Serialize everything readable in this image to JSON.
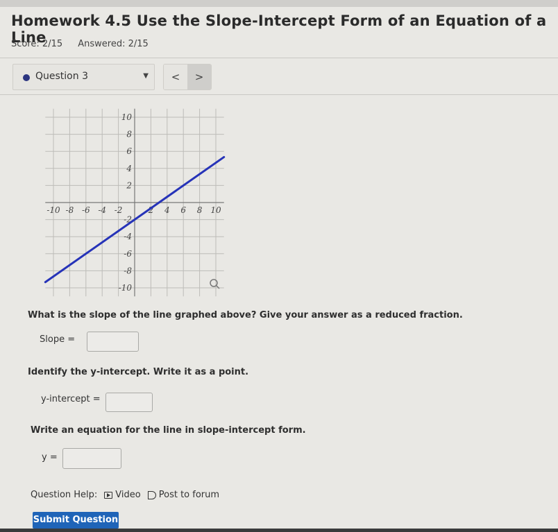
{
  "header": {
    "title": "Homework 4.5 Use the Slope-Intercept Form of an Equation of a Line",
    "score": "Score: 2/15",
    "answered": "Answered: 2/15"
  },
  "question_nav": {
    "selected": "Question 3",
    "prev_label": "<",
    "next_label": ">",
    "dot_color": "#2c3580"
  },
  "chart_data": {
    "type": "line",
    "title": "",
    "xlabel": "",
    "ylabel": "",
    "xlim": [
      -11,
      11
    ],
    "ylim": [
      -11,
      11
    ],
    "grid": true,
    "x_ticks": [
      "-10",
      "-8",
      "-6",
      "-4",
      "-2",
      "2",
      "4",
      "6",
      "8",
      "10"
    ],
    "y_ticks": [
      "10",
      "8",
      "6",
      "4",
      "2",
      "-2",
      "-4",
      "-6",
      "-8",
      "-10"
    ],
    "series": [
      {
        "name": "line",
        "color": "#2633b8",
        "x": [
          -11,
          11
        ],
        "y": [
          -9.33,
          5.33
        ]
      }
    ],
    "zoom_icon": "magnifier-icon"
  },
  "questions": {
    "q1_text": "What is the slope of the line graphed above? Give your answer as a reduced fraction.",
    "q1_label": "Slope =",
    "q1_value": "",
    "q2_text": "Identify the y-intercept. Write it as a point.",
    "q2_label": "y-intercept =",
    "q2_value": "",
    "q3_text": "Write an equation for the line in slope-intercept form.",
    "q3_label": "y =",
    "q3_value": ""
  },
  "help": {
    "label": "Question Help:",
    "video": "Video",
    "forum": "Post to forum"
  },
  "submit_label": "Submit Question"
}
